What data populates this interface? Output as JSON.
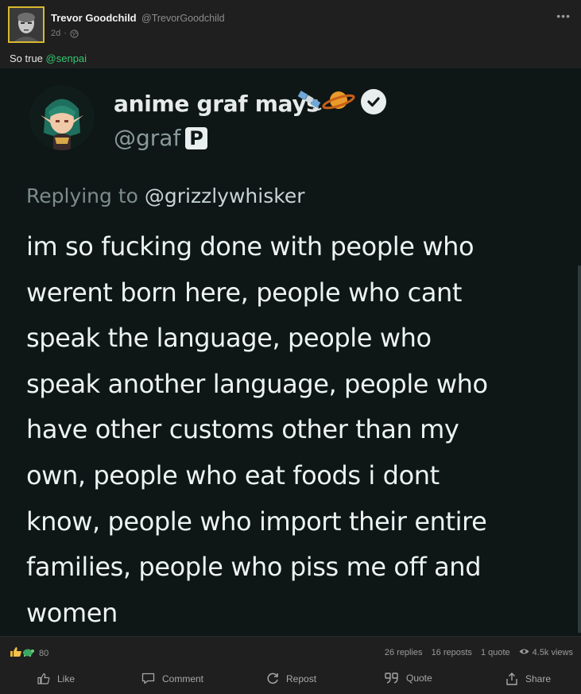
{
  "post": {
    "author_name": "Trevor Goodchild",
    "author_handle": "@TrevorGoodchild",
    "age": "2d",
    "more_label": "•••",
    "text_prefix": "So true ",
    "mention": "@senpai"
  },
  "embed": {
    "display_name": "anime graf mays",
    "emoji": [
      "satellite",
      "ringed-planet"
    ],
    "verified": true,
    "handle": "@graf",
    "badge_letter": "P",
    "replying_prefix": "Replying to ",
    "replying_handle": "@grizzlywhisker",
    "text_lines": [
      "im so fucking done with people who",
      "werent born here, people who cant",
      "speak the language, people who",
      "speak another language, people who",
      "have other customs other than my",
      "own, people who eat foods i dont",
      "know, people who import their entire",
      "families, people who piss me off and",
      "women"
    ]
  },
  "stats": {
    "reaction_count": "80",
    "replies": "26 replies",
    "reposts": "16 reposts",
    "quotes": "1 quote",
    "views": "4.5k views"
  },
  "actions": {
    "like": "Like",
    "comment": "Comment",
    "repost": "Repost",
    "quote": "Quote",
    "share": "Share"
  },
  "colors": {
    "accent_mention": "#34c771",
    "avatar_border": "#d8b92e",
    "embed_background": "#0e1616"
  }
}
